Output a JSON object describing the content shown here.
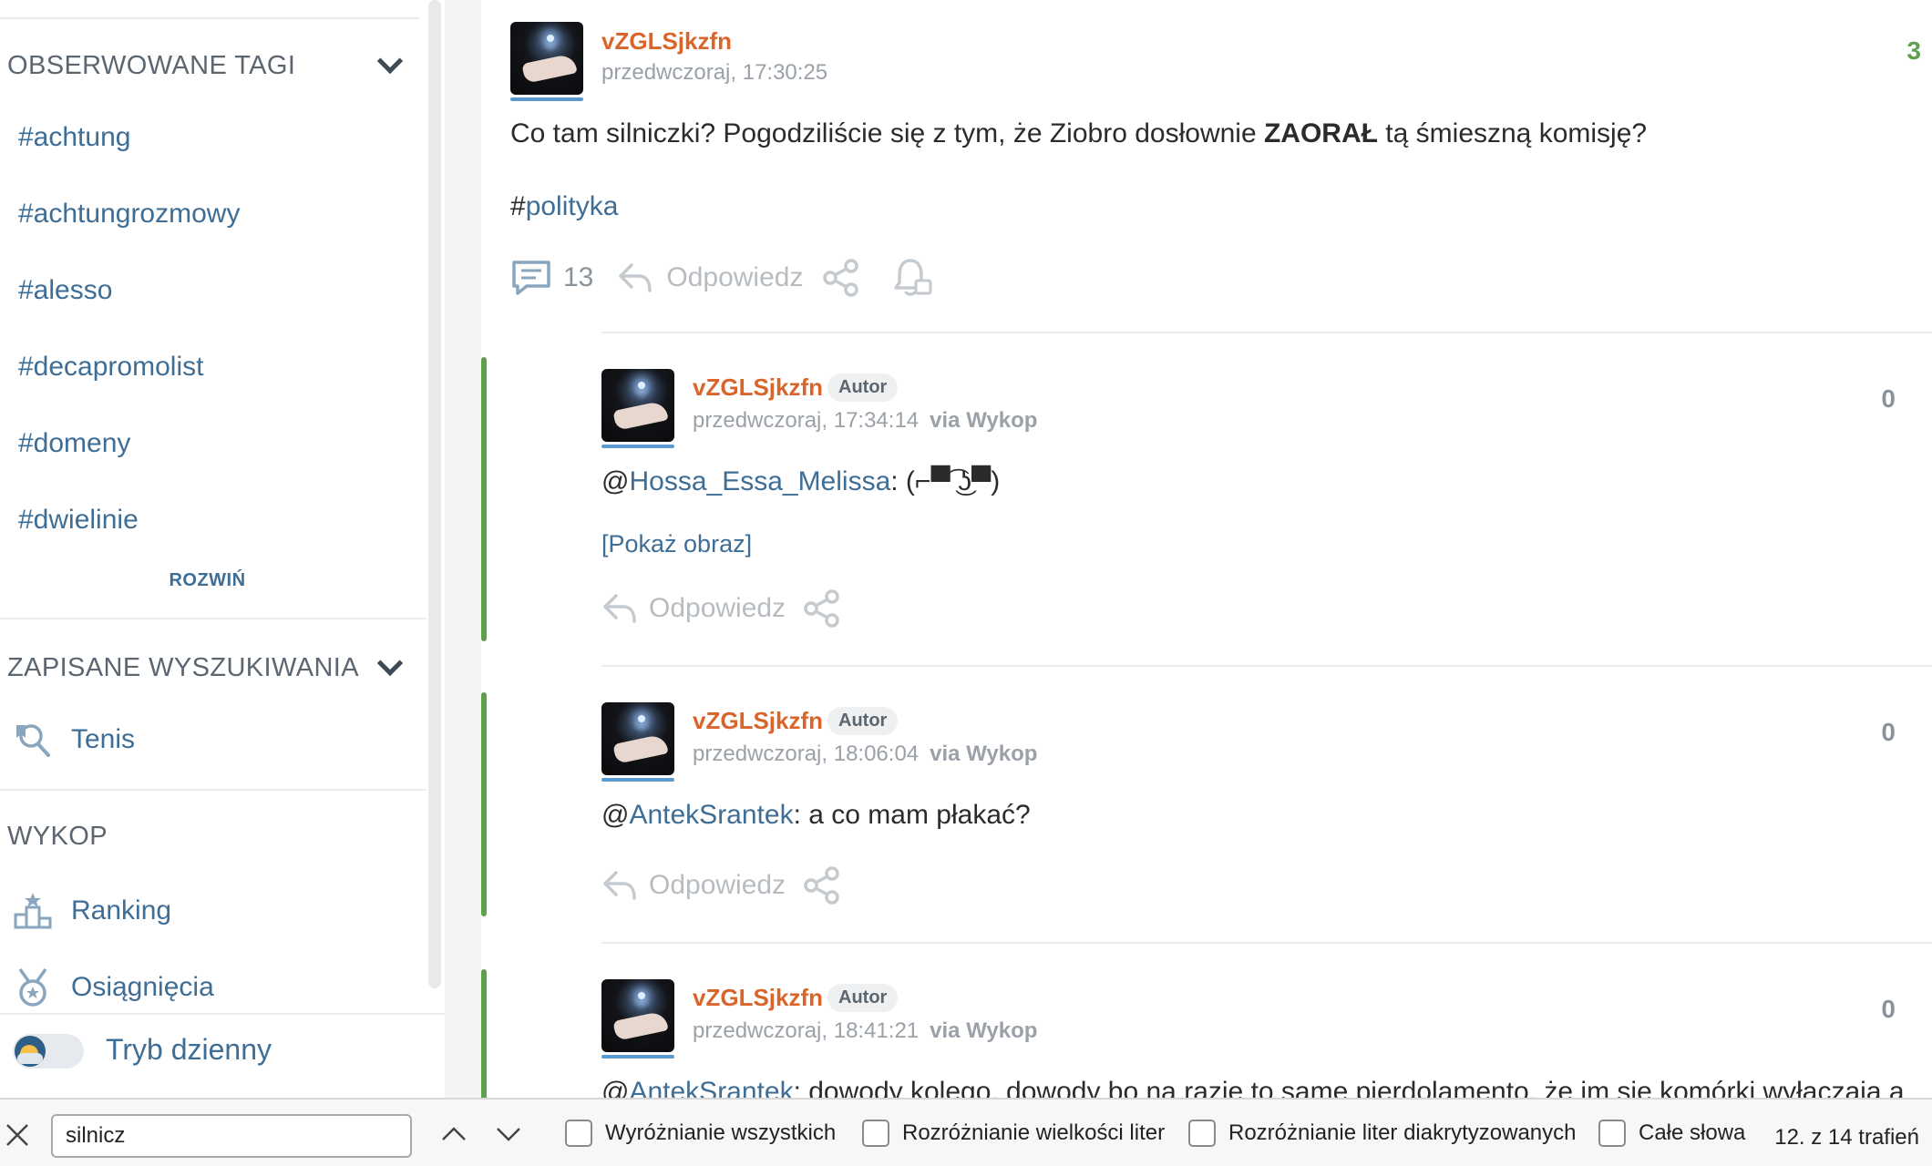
{
  "sidebar": {
    "observed_tags_title": "OBSERWOWANE TAGI",
    "tags": [
      "#achtung",
      "#achtungrozmowy",
      "#alesso",
      "#decapromolist",
      "#domeny",
      "#dwielinie"
    ],
    "expand_label": "ROZWIŃ",
    "saved_searches_title": "ZAPISANE WYSZUKIWANIA",
    "saved_searches": [
      "Tenis"
    ],
    "wykop_title": "WYKOP",
    "wykop_items": [
      "Ranking",
      "Osiągnięcia"
    ],
    "day_mode_label": "Tryb dzienny"
  },
  "post": {
    "author": "vZGLSjkzfn",
    "time": "przedwczoraj, 17:30:25",
    "score": "3",
    "text_before": "Co tam silniczki? Pogodziliście się z tym, że Ziobro dosłownie ",
    "text_bold": "ZAORAŁ",
    "text_after": " tą śmieszną komisję?",
    "hash": "#",
    "tag": "polityka",
    "comments_count": "13",
    "reply_label": "Odpowiedz"
  },
  "comments": [
    {
      "author": "vZGLSjkzfn",
      "badge": "Autor",
      "time": "przedwczoraj, 17:34:14",
      "via": "via Wykop",
      "score": "0",
      "at": "@",
      "mention": "Hossa_Essa_Melissa",
      "text": ": (⌐▀͡ ͜ʖ▀)",
      "extra": "[Pokaż obraz]",
      "reply_label": "Odpowiedz"
    },
    {
      "author": "vZGLSjkzfn",
      "badge": "Autor",
      "time": "przedwczoraj, 18:06:04",
      "via": "via Wykop",
      "score": "0",
      "at": "@",
      "mention": "AntekSrantek",
      "text": ": a co mam płakać?",
      "reply_label": "Odpowiedz"
    },
    {
      "author": "vZGLSjkzfn",
      "badge": "Autor",
      "time": "przedwczoraj, 18:41:21",
      "via": "via Wykop",
      "score": "0",
      "at": "@",
      "mention": "AntekSrantek",
      "text": ": dowody kolego, dowody bo na razie to same pierdolamento, że im się komórki wyłączają a"
    }
  ],
  "findbar": {
    "query": "silnicz",
    "highlight_all": "Wyróżnianie wszystkich",
    "match_case": "Rozróżnianie wielkości liter",
    "match_diacritics": "Rozróżnianie liter diakrytyzowanych",
    "whole_words": "Całe słowa",
    "result_count": "12. z 14 trafień"
  },
  "colors": {
    "link": "#3e6d95",
    "author": "#d9652b",
    "score_positive": "#5fa04e",
    "thread_bar": "#5fa04e"
  }
}
